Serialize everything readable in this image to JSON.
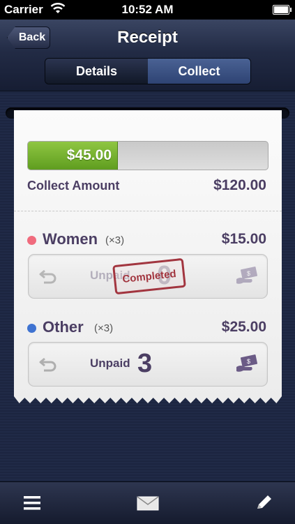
{
  "status_bar": {
    "carrier": "Carrier",
    "time": "10:52 AM"
  },
  "nav": {
    "back_label": "Back",
    "title": "Receipt"
  },
  "segments": [
    {
      "label": "Details",
      "selected": false
    },
    {
      "label": "Collect",
      "selected": true
    }
  ],
  "collect": {
    "collected": "$45.00",
    "collected_fraction": 0.375,
    "label": "Collect Amount",
    "total": "$120.00"
  },
  "items": [
    {
      "name": "Women",
      "qty": "(×3)",
      "price": "$15.00",
      "dot_color": "#f06b7d",
      "status": "Unpaid",
      "count": "0",
      "stamp": "Completed"
    },
    {
      "name": "Other",
      "qty": "(×3)",
      "price": "$25.00",
      "dot_color": "#3f73d1",
      "status": "Unpaid",
      "count": "3"
    }
  ],
  "colors": {
    "accent": "#4b3e63",
    "progress_green": "#6fae2a",
    "stamp_red": "#a2353f"
  }
}
